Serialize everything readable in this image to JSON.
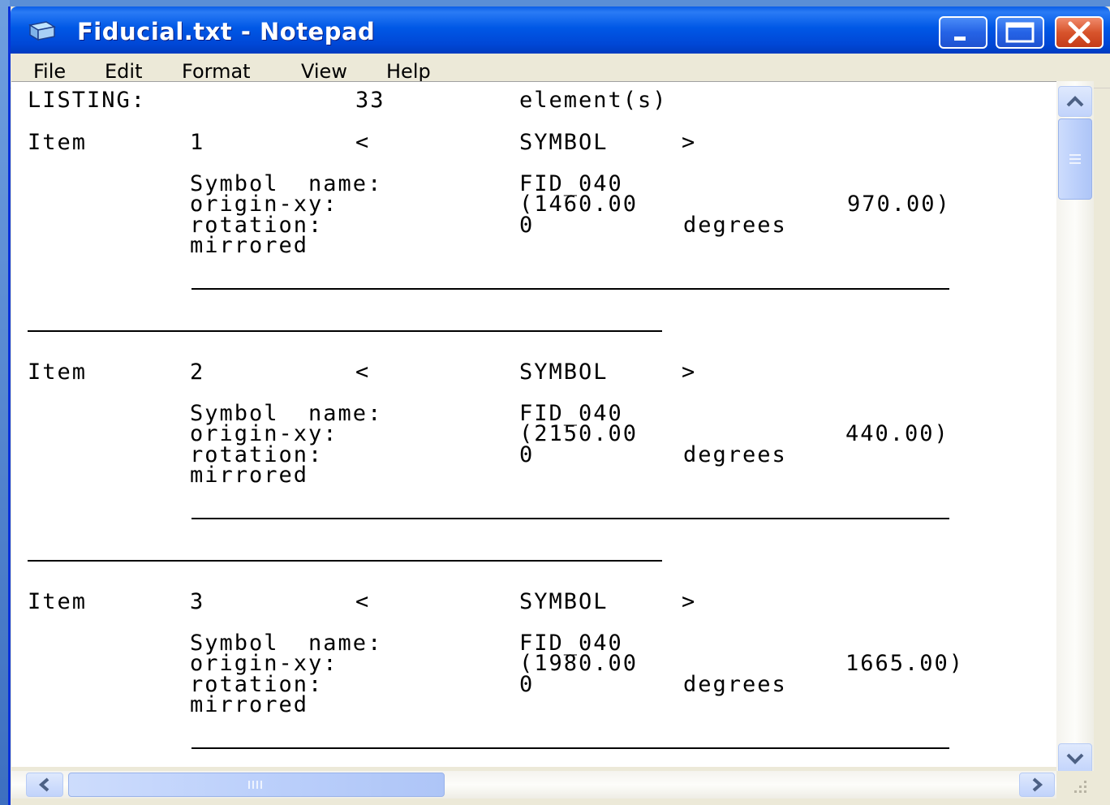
{
  "window": {
    "title": "Fiducial.txt - Notepad",
    "app_icon": "notepad-icon",
    "controls": [
      "minimize-icon",
      "maximize-icon",
      "close-icon"
    ]
  },
  "menu": [
    "File",
    "Edit",
    "Format",
    "View",
    "Help"
  ],
  "header": {
    "label": "LISTING:",
    "count": "33",
    "unit": "element(s)"
  },
  "items": [
    {
      "item_label": "Item",
      "number": "1",
      "lt": "<",
      "type": "SYMBOL",
      "gt": ">",
      "symbol_name_label": "Symbol  name:",
      "symbol_name": "FID_040",
      "origin_label": "origin-xy:",
      "origin_x": "(1460.00",
      "origin_y": "970.00)",
      "rotation_label": "rotation:",
      "rotation_value": "0",
      "rotation_unit": "degrees",
      "mirrored": "mirrored"
    },
    {
      "item_label": "Item",
      "number": "2",
      "lt": "<",
      "type": "SYMBOL",
      "gt": ">",
      "symbol_name_label": "Symbol  name:",
      "symbol_name": "FID_040",
      "origin_label": "origin-xy:",
      "origin_x": "(2150.00",
      "origin_y": "440.00)",
      "rotation_label": "rotation:",
      "rotation_value": "0",
      "rotation_unit": "degrees",
      "mirrored": "mirrored"
    },
    {
      "item_label": "Item",
      "number": "3",
      "lt": "<",
      "type": "SYMBOL",
      "gt": ">",
      "symbol_name_label": "Symbol  name:",
      "symbol_name": "FID_040",
      "origin_label": "origin-xy:",
      "origin_x": "(1980.00",
      "origin_y": "1665.00)",
      "rotation_label": "rotation:",
      "rotation_value": "0",
      "rotation_unit": "degrees",
      "mirrored": "mirrored"
    }
  ],
  "colors": {
    "titlebar": "#0058e6",
    "close_button": "#d8542c",
    "chrome": "#ece9d8",
    "text": "#000000"
  }
}
